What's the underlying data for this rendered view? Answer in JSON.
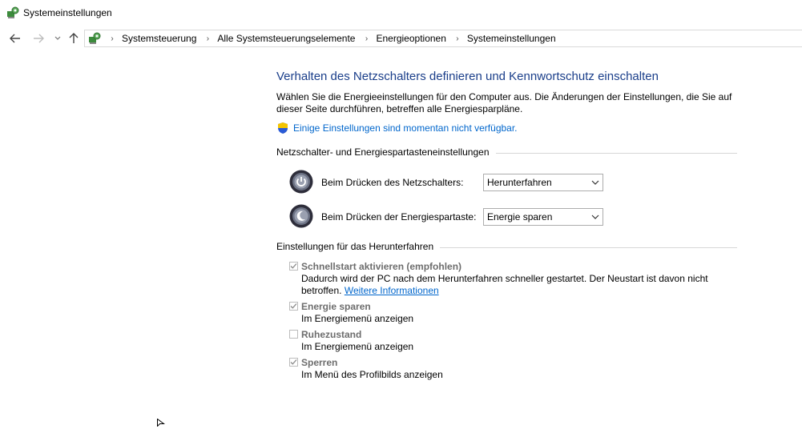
{
  "window": {
    "title": "Systemeinstellungen"
  },
  "nav": {
    "breadcrumb": [
      "Systemsteuerung",
      "Alle Systemsteuerungselemente",
      "Energieoptionen",
      "Systemeinstellungen"
    ]
  },
  "main": {
    "heading": "Verhalten des Netzschalters definieren und Kennwortschutz einschalten",
    "description": "Wählen Sie die Energieeinstellungen für den Computer aus. Die Änderungen der Einstellungen, die Sie auf dieser Seite durchführen, betreffen alle Energiesparpläne.",
    "unavailable_link": "Einige Einstellungen sind momentan nicht verfügbar.",
    "power_group": {
      "title": "Netzschalter- und Energiespartasteneinstellungen",
      "power_button": {
        "label": "Beim Drücken des Netzschalters:",
        "value": "Herunterfahren"
      },
      "sleep_button": {
        "label": "Beim Drücken der Energiespartaste:",
        "value": "Energie sparen"
      }
    },
    "shutdown_group": {
      "title": "Einstellungen für das Herunterfahren",
      "options": [
        {
          "title": "Schnellstart aktivieren (empfohlen)",
          "checked": true,
          "desc": "Dadurch wird der PC nach dem Herunterfahren schneller gestartet. Der Neustart ist davon nicht betroffen.",
          "link": "Weitere Informationen"
        },
        {
          "title": "Energie sparen",
          "checked": true,
          "desc": "Im Energiemenü anzeigen"
        },
        {
          "title": "Ruhezustand",
          "checked": false,
          "desc": "Im Energiemenü anzeigen"
        },
        {
          "title": "Sperren",
          "checked": true,
          "desc": "Im Menü des Profilbilds anzeigen"
        }
      ]
    }
  },
  "colors": {
    "heading": "#1a3e8a",
    "link": "#0066cc",
    "disabled_text": "#6d6d6d"
  },
  "icons": {
    "app": "control-panel-icon",
    "back": "arrow-left-icon",
    "forward": "arrow-right-icon",
    "recent": "chevron-down-icon",
    "up": "arrow-up-icon",
    "shield": "uac-shield-icon",
    "power": "power-icon",
    "sleep": "moon-icon"
  }
}
